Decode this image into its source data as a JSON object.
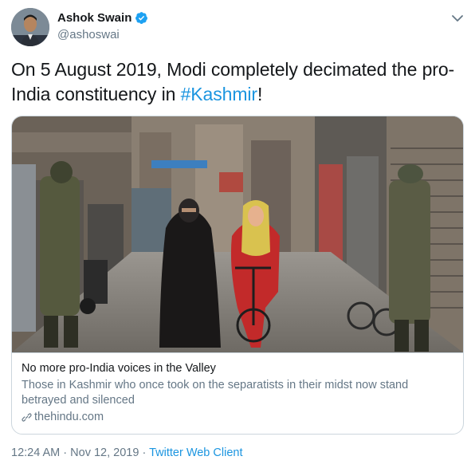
{
  "user": {
    "display_name": "Ashok Swain",
    "handle": "@ashoswai",
    "verified": true
  },
  "tweet": {
    "text_before": "On 5 August 2019, Modi completely decimated the pro-India constituency in ",
    "hashtag": "#Kashmir",
    "text_after": "!"
  },
  "card": {
    "title": "No more pro-India voices in the Valley",
    "description": "Those in Kashmir who once took on the separatists in their midst now stand betrayed and silenced",
    "domain": "thehindu.com"
  },
  "meta": {
    "time": "12:24 AM",
    "separator": "·",
    "date": "Nov 12, 2019",
    "source": "Twitter Web Client"
  },
  "colors": {
    "link": "#1b95e0",
    "secondary_text": "#657786",
    "border": "#ccd6dd"
  },
  "icons": {
    "verified": "verified-badge-icon",
    "caret": "chevron-down-icon",
    "link": "link-icon"
  }
}
